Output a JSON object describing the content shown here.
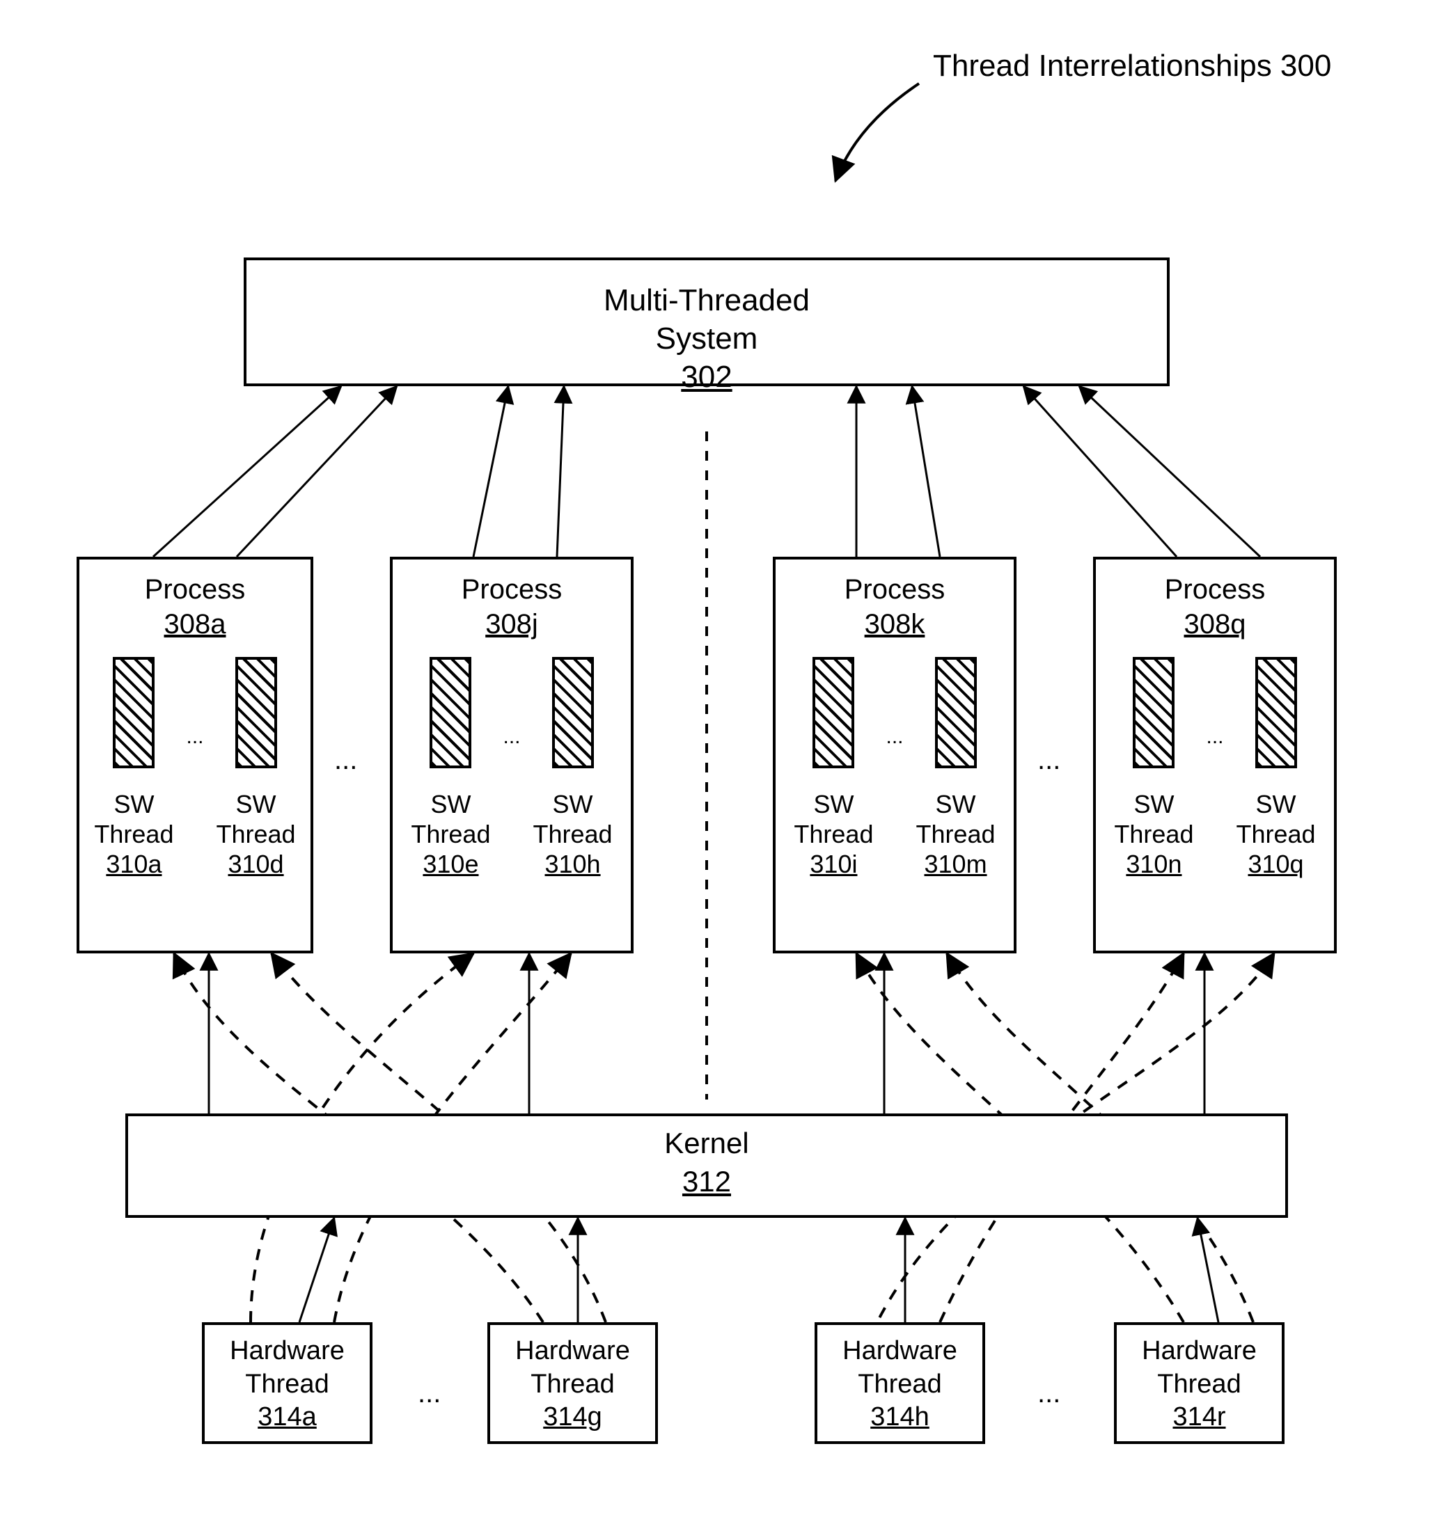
{
  "title": "Thread Interrelationships 300",
  "system": {
    "line1": "Multi-Threaded",
    "line2": "System",
    "ref": "302"
  },
  "processes": [
    {
      "label": "Process",
      "ref": "308a",
      "threads": [
        {
          "l1": "SW",
          "l2": "Thread",
          "ref": "310a"
        },
        {
          "l1": "SW",
          "l2": "Thread",
          "ref": "310d"
        }
      ]
    },
    {
      "label": "Process",
      "ref": "308j",
      "threads": [
        {
          "l1": "SW",
          "l2": "Thread",
          "ref": "310e"
        },
        {
          "l1": "SW",
          "l2": "Thread",
          "ref": "310h"
        }
      ]
    },
    {
      "label": "Process",
      "ref": "308k",
      "threads": [
        {
          "l1": "SW",
          "l2": "Thread",
          "ref": "310i"
        },
        {
          "l1": "SW",
          "l2": "Thread",
          "ref": "310m"
        }
      ]
    },
    {
      "label": "Process",
      "ref": "308q",
      "threads": [
        {
          "l1": "SW",
          "l2": "Thread",
          "ref": "310n"
        },
        {
          "l1": "SW",
          "l2": "Thread",
          "ref": "310q"
        }
      ]
    }
  ],
  "kernel": {
    "label": "Kernel",
    "ref": "312"
  },
  "hardware_threads": [
    {
      "l1": "Hardware",
      "l2": "Thread",
      "ref": "314a"
    },
    {
      "l1": "Hardware",
      "l2": "Thread",
      "ref": "314g"
    },
    {
      "l1": "Hardware",
      "l2": "Thread",
      "ref": "314h"
    },
    {
      "l1": "Hardware",
      "l2": "Thread",
      "ref": "314r"
    }
  ],
  "ellipsis": "..."
}
